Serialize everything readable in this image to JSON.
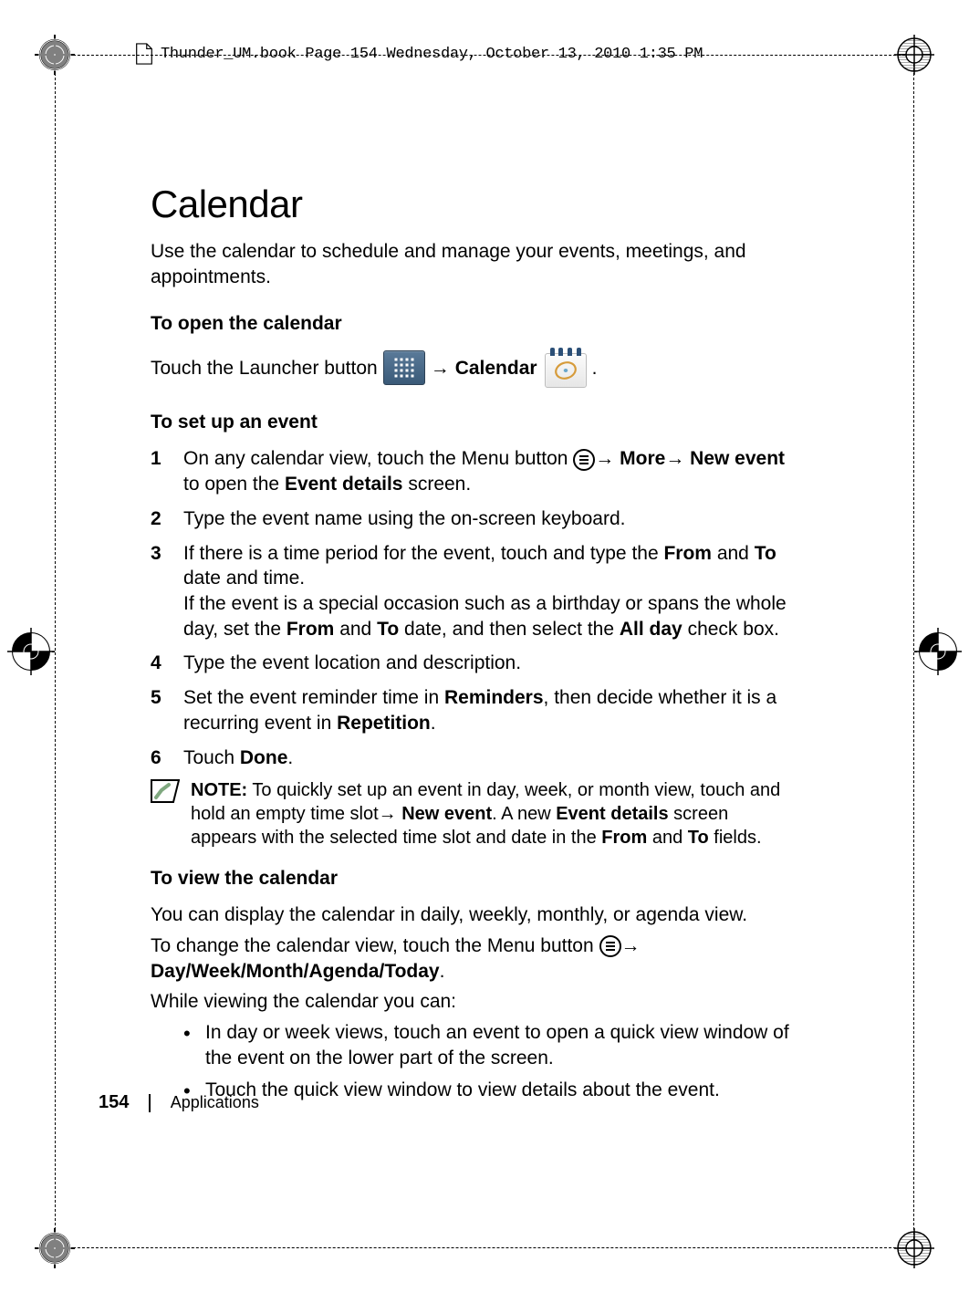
{
  "header": {
    "running_head": "Thunder_UM.book  Page 154  Wednesday, October 13, 2010  1:35 PM"
  },
  "title": "Calendar",
  "intro": "Use the calendar to schedule and manage your events, meetings, and appointments.",
  "subheads": {
    "open": "To open the calendar",
    "setup": "To set up an event",
    "view": "To view the calendar"
  },
  "open_line": {
    "prefix": "Touch the Launcher button ",
    "arrow1": " → ",
    "calendar_label": "Calendar",
    "suffix": "."
  },
  "steps": {
    "s1a": "On any calendar view, touch the Menu button ",
    "s1b": "→ ",
    "s1c": "More",
    "s1d": "→ ",
    "s1e": "New event",
    "s1f": " to open the ",
    "s1g": "Event details",
    "s1h": " screen.",
    "s2": "Type the event name using the on-screen keyboard.",
    "s3a": "If there is a time period for the event, touch and type the ",
    "s3b": "From",
    "s3c": " and ",
    "s3d": "To",
    "s3e": " date and time.",
    "s3f": "If the event is a special occasion such as a birthday or spans the whole day, set the ",
    "s3g": "From",
    "s3h": " and ",
    "s3i": "To",
    "s3j": " date, and then select the ",
    "s3k": "All day",
    "s3l": " check box.",
    "s4": "Type the event location and description.",
    "s5a": "Set the event reminder time in ",
    "s5b": "Reminders",
    "s5c": ", then decide whether it is a recurring event in ",
    "s5d": "Repetition",
    "s5e": ".",
    "s6a": "Touch ",
    "s6b": "Done",
    "s6c": "."
  },
  "note": {
    "label": "NOTE:",
    "a": " To quickly set up an event in day, week, or month view, touch and hold an empty time slot→ ",
    "b": "New event",
    "c": ". A new ",
    "d": "Event details",
    "e": " screen appears with the selected time slot and date in the ",
    "f": "From",
    "g": " and ",
    "h": "To",
    "i": " fields."
  },
  "view": {
    "p1": "You can display the calendar in daily, weekly, monthly, or agenda view.",
    "p2a": "To change the calendar view, touch the Menu button ",
    "p2b": "→ ",
    "p2c": "Day/Week/Month/Agenda/Today",
    "p2d": ".",
    "p3": "While viewing the calendar you can:",
    "b1": "In day or week views, touch an event to open a quick view window of the event on the lower part of the screen.",
    "b2": "Touch the quick view window to view details about the event."
  },
  "footer": {
    "page": "154",
    "section": "Applications"
  }
}
